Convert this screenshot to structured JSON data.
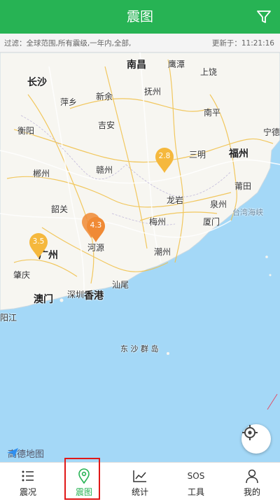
{
  "header": {
    "title": "震图",
    "filter_icon": "filter-icon"
  },
  "filterbar": {
    "filter_text": "过滤：全球范围,所有震级,一年内,全部,",
    "updated_text": "更新于：11:21:16"
  },
  "map": {
    "cities": [
      {
        "id": "nanchang",
        "name": "南昌",
        "big": true
      },
      {
        "id": "changsha",
        "name": "长沙",
        "big": true
      },
      {
        "id": "yingtan",
        "name": "鹰潭"
      },
      {
        "id": "pingxiang",
        "name": "萍乡"
      },
      {
        "id": "xinyu",
        "name": "新余"
      },
      {
        "id": "fuzhou-jx",
        "name": "抚州"
      },
      {
        "id": "shangrao",
        "name": "上饶"
      },
      {
        "id": "hengyang",
        "name": "衡阳"
      },
      {
        "id": "ji-an",
        "name": "吉安"
      },
      {
        "id": "nanping",
        "name": "南平"
      },
      {
        "id": "ningde",
        "name": "宁德"
      },
      {
        "id": "sanming",
        "name": "三明"
      },
      {
        "id": "fuzhou",
        "name": "福州",
        "big": true
      },
      {
        "id": "chenzhou",
        "name": "郴州"
      },
      {
        "id": "ganzhou",
        "name": "赣州"
      },
      {
        "id": "putian",
        "name": "莆田"
      },
      {
        "id": "shaoguan",
        "name": "韶关"
      },
      {
        "id": "longyan",
        "name": "龙岩"
      },
      {
        "id": "quanzhou",
        "name": "泉州"
      },
      {
        "id": "taiwan-strait",
        "name": "台湾海峡"
      },
      {
        "id": "meizhou",
        "name": "梅州"
      },
      {
        "id": "xiamen",
        "name": "厦门"
      },
      {
        "id": "heyuan",
        "name": "河源"
      },
      {
        "id": "chaozhou",
        "name": "潮州"
      },
      {
        "id": "guangzhou",
        "name": "广州",
        "big": true
      },
      {
        "id": "zhaoqing",
        "name": "肇庆"
      },
      {
        "id": "shantou",
        "name": "汕尾"
      },
      {
        "id": "shenzhen",
        "name": "深圳"
      },
      {
        "id": "hongkong",
        "name": "香港",
        "big": true
      },
      {
        "id": "macau",
        "name": "澳门",
        "big": true
      },
      {
        "id": "yangjiang",
        "name": "阳江"
      },
      {
        "id": "dongsha",
        "name": "东 沙 群 岛"
      }
    ],
    "markers": [
      {
        "id": "m1",
        "magnitude": "2.8",
        "color": "#f5b83d"
      },
      {
        "id": "m2",
        "magnitude": "4.3",
        "color": "#f08a35"
      },
      {
        "id": "m3",
        "magnitude": "3.5",
        "color": "#f5b83d"
      }
    ],
    "logo_text": "高德地图",
    "locate_icon": "crosshair-icon"
  },
  "tabs": [
    {
      "label": "震况",
      "icon": "list-icon",
      "active": false
    },
    {
      "label": "震图",
      "icon": "map-pin-icon",
      "active": true
    },
    {
      "label": "统计",
      "icon": "chart-icon",
      "active": false
    },
    {
      "label": "工具",
      "icon": "sos-icon",
      "active": false,
      "icon_text": "SOS"
    },
    {
      "label": "我的",
      "icon": "user-icon",
      "active": false
    }
  ],
  "colors": {
    "brand": "#27b354",
    "sea": "#a4d8f7",
    "land": "#f7f6f1",
    "highlight": "#e01818"
  }
}
